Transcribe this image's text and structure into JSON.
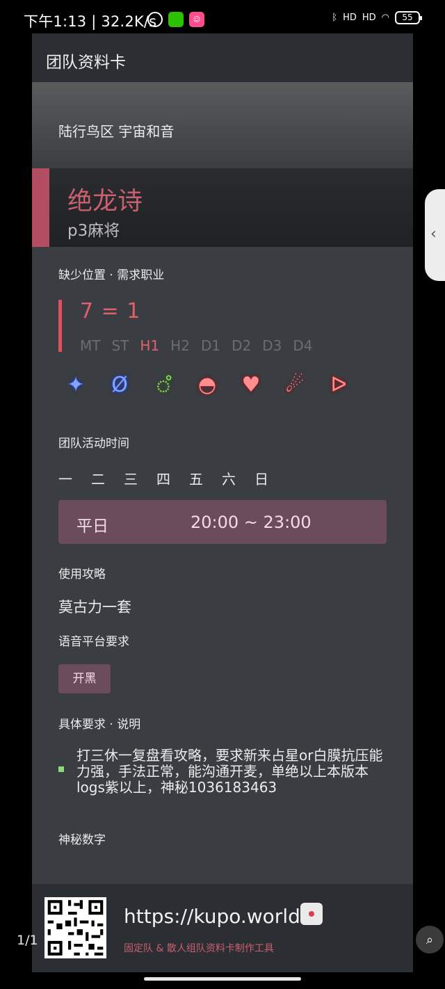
{
  "status_bar": {
    "time_speed": "下午1:13 | 32.2K/s",
    "battery": "55",
    "signal_label": "HD"
  },
  "card": {
    "header_title": "团队资料卡",
    "server": "陆行鸟区 宇宙和音",
    "team_name": "绝龙诗",
    "team_subtitle": "p3麻将",
    "missing": {
      "label": "缺少位置 · 需求职业",
      "formula": "7 = 1",
      "positions": [
        {
          "name": "MT",
          "active": false
        },
        {
          "name": "ST",
          "active": false
        },
        {
          "name": "H1",
          "active": true
        },
        {
          "name": "H2",
          "active": false
        },
        {
          "name": "D1",
          "active": false
        },
        {
          "name": "D2",
          "active": false
        },
        {
          "name": "D3",
          "active": false
        },
        {
          "name": "D4",
          "active": false
        }
      ],
      "job_icons": [
        {
          "icon": "paladin-job-icon",
          "role": "tank",
          "glyph": "✦"
        },
        {
          "icon": "dark-knight-job-icon",
          "role": "tank",
          "glyph": "Ø"
        },
        {
          "icon": "scholar-job-icon",
          "role": "heal",
          "glyph": "ஂ"
        },
        {
          "icon": "dragoon-job-icon",
          "role": "dps",
          "glyph": "◓"
        },
        {
          "icon": "monk-job-icon",
          "role": "dps",
          "glyph": "♥"
        },
        {
          "icon": "black-mage-job-icon",
          "role": "dps",
          "glyph": "☄"
        },
        {
          "icon": "bard-job-icon",
          "role": "dps",
          "glyph": "ᐅ"
        }
      ]
    },
    "activity": {
      "label": "团队活动时间",
      "days": [
        "一",
        "二",
        "三",
        "四",
        "五",
        "六",
        "日"
      ],
      "slot_day": "平日",
      "slot_range": "20:00 ~ 23:00"
    },
    "strategy": {
      "label": "使用攻略",
      "value": "莫古力一套"
    },
    "voice": {
      "label": "语音平台要求",
      "tag": "开黑"
    },
    "requirements": {
      "label": "具体要求 · 说明",
      "text": "打三休一复盘看攻略，要求新来占星or白膜抗压能力强，手法正常，能沟通开麦，单绝以上本版本logs紫以上，神秘1036183463"
    },
    "secret": {
      "label": "神秘数字"
    },
    "footer": {
      "url": "https://kupo.world",
      "tagline": "固定队 & 散人组队资料卡制作工具"
    }
  },
  "viewer": {
    "page_indicator": "1/1"
  },
  "colors": {
    "accent_red": "#e2606a",
    "tag_bg": "#6a4c5c",
    "card_bg": "#3a3d42"
  }
}
